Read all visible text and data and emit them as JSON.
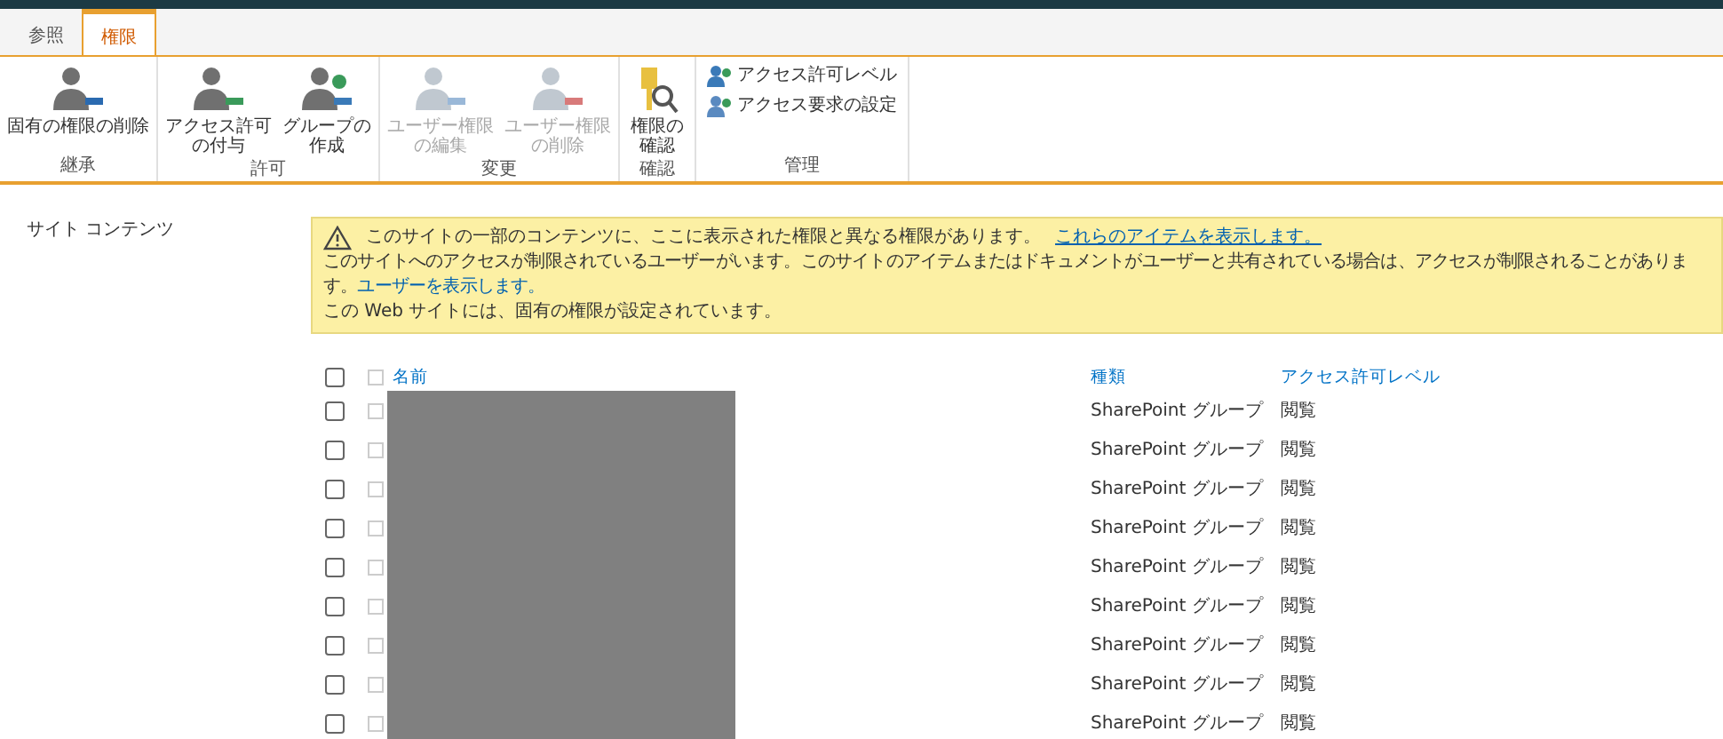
{
  "tabs": [
    {
      "label": "参照",
      "selected": false
    },
    {
      "label": "権限",
      "selected": true
    }
  ],
  "ribbon": {
    "groups": [
      {
        "label": "継承",
        "buttons": [
          {
            "lines": [
              "固有の権限の削除"
            ],
            "disabled": false
          }
        ]
      },
      {
        "label": "許可",
        "buttons": [
          {
            "lines": [
              "アクセス許可",
              "の付与"
            ],
            "disabled": false
          },
          {
            "lines": [
              "グループの",
              "作成"
            ],
            "disabled": false
          }
        ]
      },
      {
        "label": "変更",
        "buttons": [
          {
            "lines": [
              "ユーザー権限",
              "の編集"
            ],
            "disabled": true
          },
          {
            "lines": [
              "ユーザー権限",
              "の削除"
            ],
            "disabled": true
          }
        ]
      },
      {
        "label": "確認",
        "buttons": [
          {
            "lines": [
              "権限の",
              "確認"
            ],
            "disabled": false
          }
        ]
      },
      {
        "label": "管理",
        "small": [
          {
            "label": "アクセス許可レベル"
          },
          {
            "label": "アクセス要求の設定"
          }
        ]
      }
    ]
  },
  "sidebar": {
    "items": [
      "サイト コンテンツ"
    ]
  },
  "notice": {
    "line1": "このサイトの一部のコンテンツに、ここに表示された権限と異なる権限があります。",
    "line1_link": "これらのアイテムを表示します。",
    "line2": "このサイトへのアクセスが制限されているユーザーがいます。このサイトのアイテムまたはドキュメントがユーザーと共有されている場合は、アクセスが制限されることがあります。",
    "line2_link": "ユーザーを表示します。",
    "line3": "この  Web サイトには、固有の権限が設定されています。"
  },
  "table": {
    "select_all": false,
    "columns": [
      "名前",
      "種類",
      "アクセス許可レベル"
    ],
    "rows": [
      {
        "selected": false,
        "type": "SharePoint グループ",
        "level": "閲覧"
      },
      {
        "selected": false,
        "type": "SharePoint グループ",
        "level": "閲覧"
      },
      {
        "selected": false,
        "type": "SharePoint グループ",
        "level": "閲覧"
      },
      {
        "selected": false,
        "type": "SharePoint グループ",
        "level": "閲覧"
      },
      {
        "selected": false,
        "type": "SharePoint グループ",
        "level": "閲覧"
      },
      {
        "selected": false,
        "type": "SharePoint グループ",
        "level": "閲覧"
      },
      {
        "selected": false,
        "type": "SharePoint グループ",
        "level": "閲覧"
      },
      {
        "selected": false,
        "type": "SharePoint グループ",
        "level": "閲覧"
      },
      {
        "selected": false,
        "type": "SharePoint グループ",
        "level": "閲覧"
      }
    ]
  }
}
